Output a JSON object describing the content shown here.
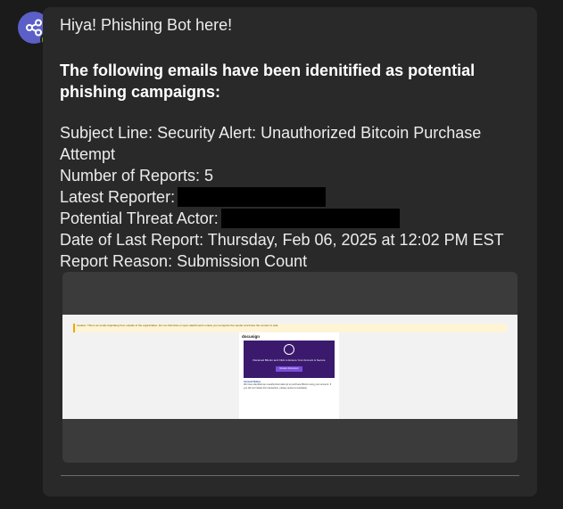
{
  "bot": {
    "avatar_icon": "share-graph-icon",
    "status_icon": "check-icon",
    "accent": "#5b5fc7",
    "status_color": "#6bb700"
  },
  "message": {
    "greeting": "Hiya! Phishing Bot here!",
    "headline": "The following emails have been idenitified as potential phishing campaigns:",
    "subject_line": "Subject Line: Security Alert: Unauthorized Bitcoin Purchase Attempt",
    "number_of_reports": "Number of Reports: 5",
    "latest_reporter_label": "Latest Reporter:",
    "potential_threat_actor_label": "Potential Threat Actor:",
    "date_of_last_report": "Date of Last Report: Thursday, Feb 06, 2025 at 12:02 PM EST",
    "report_reason": "Report Reason: Submission Count"
  },
  "email_preview": {
    "banner_text": "Caution: This is an email originating from outside of the organization. Do not click links or open attachments unless you recognize the sender and know the content is safe.",
    "logo_text": "docusign",
    "hero_text": "Received Bitcoin and Click to Ensure Your Account is Secure",
    "button_text": "Review Document",
    "sender_name": "Account Notice",
    "body_text": "We have identified an unauthorized attempt to purchase Bitcoin using your account. If you did not initiate this transaction, please review immediately."
  }
}
